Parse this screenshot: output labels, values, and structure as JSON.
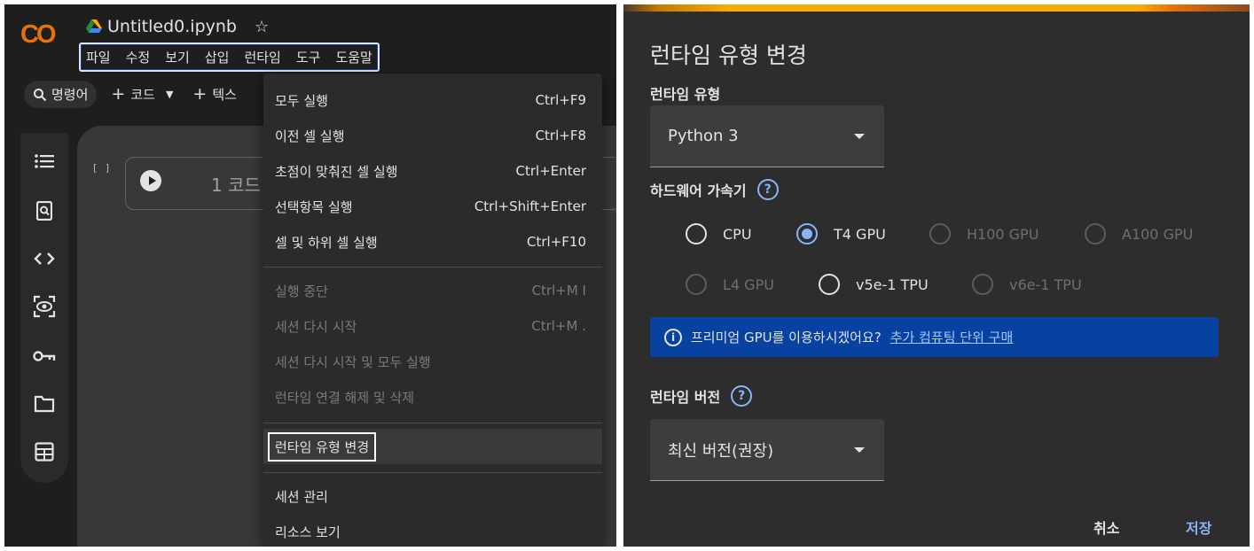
{
  "colab": {
    "logo": "CO",
    "notebook_title": "Untitled0.ipynb",
    "menu": [
      "파일",
      "수정",
      "보기",
      "삽입",
      "런타임",
      "도구",
      "도움말"
    ],
    "toolbar": {
      "command": "명령어",
      "code": "코드",
      "text": "텍스"
    },
    "cell": {
      "bracket": "[ ]",
      "line": "1 코드"
    },
    "sidebar_icons": [
      "toc-icon",
      "find-icon",
      "code-snippets-icon",
      "variables-icon",
      "secrets-key-icon",
      "folder-icon",
      "data-table-icon"
    ]
  },
  "runtime_menu": {
    "group1": [
      {
        "label": "모두 실행",
        "shortcut": "Ctrl+F9"
      },
      {
        "label": "이전 셀 실행",
        "shortcut": "Ctrl+F8"
      },
      {
        "label": "초점이 맞춰진 셀 실행",
        "shortcut": "Ctrl+Enter"
      },
      {
        "label": "선택항목 실행",
        "shortcut": "Ctrl+Shift+Enter"
      },
      {
        "label": "셀 및 하위 셀 실행",
        "shortcut": "Ctrl+F10"
      }
    ],
    "group2": [
      {
        "label": "실행 중단",
        "shortcut": "Ctrl+M I"
      },
      {
        "label": "세션 다시 시작",
        "shortcut": "Ctrl+M ."
      },
      {
        "label": "세션 다시 시작 및 모두 실행",
        "shortcut": ""
      },
      {
        "label": "런타임 연결 해제 및 삭제",
        "shortcut": ""
      }
    ],
    "change_runtime": "런타임 유형 변경",
    "group3": [
      {
        "label": "세션 관리"
      },
      {
        "label": "리소스 보기"
      }
    ]
  },
  "dialog": {
    "title": "런타임 유형 변경",
    "runtime_type_label": "런타임 유형",
    "runtime_type_value": "Python 3",
    "accelerator_label": "하드웨어 가속기",
    "accelerators": [
      {
        "label": "CPU",
        "state": "enabled"
      },
      {
        "label": "T4 GPU",
        "state": "selected"
      },
      {
        "label": "H100 GPU",
        "state": "disabled"
      },
      {
        "label": "A100 GPU",
        "state": "disabled"
      },
      {
        "label": "L4 GPU",
        "state": "disabled"
      },
      {
        "label": "v5e-1 TPU",
        "state": "enabled"
      },
      {
        "label": "v6e-1 TPU",
        "state": "disabled"
      }
    ],
    "banner_text": "프리미엄 GPU를 이용하시겠어요?",
    "banner_link": "추가 컴퓨팅 단위 구매",
    "version_label": "런타임 버전",
    "version_value": "최신 버전(권장)",
    "cancel": "취소",
    "save": "저장"
  },
  "colors": {
    "accent": "#8ab4f8",
    "banner": "#0842a0",
    "logo_yellow": "#f9ab00",
    "logo_orange": "#e8710a"
  }
}
